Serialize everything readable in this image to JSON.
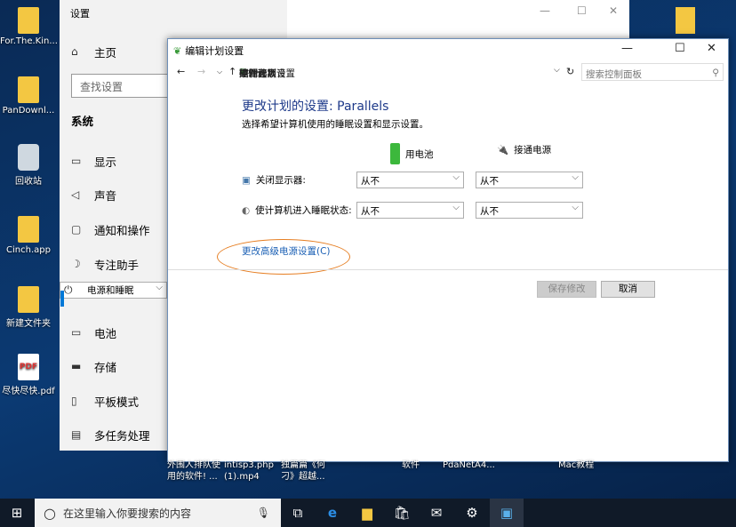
{
  "desktop": {
    "left_icons": [
      "For.The.Kin...",
      "PanDownl...",
      "回收站",
      "Cinch.app",
      "新建文件夹",
      "尽快尽快.pdf"
    ],
    "bottom_labels": [
      "外围人排队使\n用的软件! ...",
      "intisp3.php\n(1).mp4",
      "独篇篇《何\n刁》超越...",
      "软件",
      "PdaNetA4...",
      "Mac教程"
    ],
    "pdf_badge": "PDF"
  },
  "settings": {
    "title": "设置",
    "home": "主页",
    "search_placeholder": "查找设置",
    "section": "系统",
    "items": [
      {
        "label": "显示",
        "icon": "monitor-icon"
      },
      {
        "label": "声音",
        "icon": "speaker-icon"
      },
      {
        "label": "通知和操作",
        "icon": "notification-icon"
      },
      {
        "label": "专注助手",
        "icon": "moon-icon"
      },
      {
        "label": "电源和睡眠",
        "icon": "power-icon",
        "selected": true
      },
      {
        "label": "电池",
        "icon": "battery-icon"
      },
      {
        "label": "存储",
        "icon": "storage-icon"
      },
      {
        "label": "平板模式",
        "icon": "tablet-icon"
      },
      {
        "label": "多任务处理",
        "icon": "multitask-icon"
      }
    ]
  },
  "cp": {
    "title": "编辑计划设置",
    "breadcrumb": [
      "控制面板",
      "硬件和声音",
      "电源选项",
      "编辑计划设置"
    ],
    "search_placeholder": "搜索控制面板",
    "heading": "更改计划的设置: Parallels",
    "subtitle": "选择希望计算机使用的睡眠设置和显示设置。",
    "col_battery": "用电池",
    "col_plugged": "接通电源",
    "rows": [
      {
        "label": "关闭显示器:",
        "battery": "从不",
        "plugged": "从不"
      },
      {
        "label": "使计算机进入睡眠状态:",
        "battery": "从不",
        "plugged": "从不"
      }
    ],
    "advanced_link": "更改高级电源设置(C)",
    "save": "保存修改",
    "cancel": "取消",
    "highlight_color": "#e67e22"
  },
  "taskbar": {
    "search_placeholder": "在这里输入你要搜索的内容"
  }
}
